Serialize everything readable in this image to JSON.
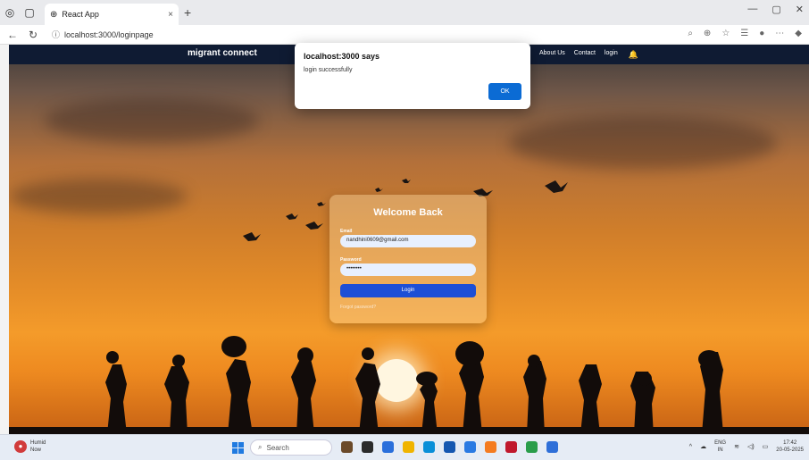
{
  "browser": {
    "tab_title": "React App",
    "url": "localhost:3000/loginpage",
    "tab_close": "×",
    "new_tab": "+"
  },
  "navbar": {
    "brand": "migrant connect",
    "links": [
      "About Us",
      "Contact",
      "login"
    ]
  },
  "login_card": {
    "title": "Welcome Back",
    "email_label": "Email",
    "email_value": "nandhini0609@gmail.com",
    "password_label": "Password",
    "password_value": "••••••••",
    "login_button": "Login",
    "forgot_link": "Forgot password?"
  },
  "alert": {
    "title": "localhost:3000 says",
    "message": "login successfully",
    "ok_button": "OK"
  },
  "taskbar": {
    "weather_title": "Humid",
    "weather_sub": "Now",
    "search_label": "Search",
    "lang_top": "ENG",
    "lang_bottom": "IN",
    "time": "17:42",
    "date": "20-05-2025",
    "icon_colors": [
      "#6b4a2a",
      "#2b2b2b",
      "#2a6fdb",
      "#f0b400",
      "#0a8fd8",
      "#1557b0",
      "#2a7ae2",
      "#f47b20",
      "#c0182d",
      "#2a9d4a",
      "#2f6fd8"
    ]
  },
  "colors": {
    "navbar_bg": "#0f1b33",
    "login_button_bg": "#1d4fd6",
    "ok_button_bg": "#0b6bd4"
  }
}
